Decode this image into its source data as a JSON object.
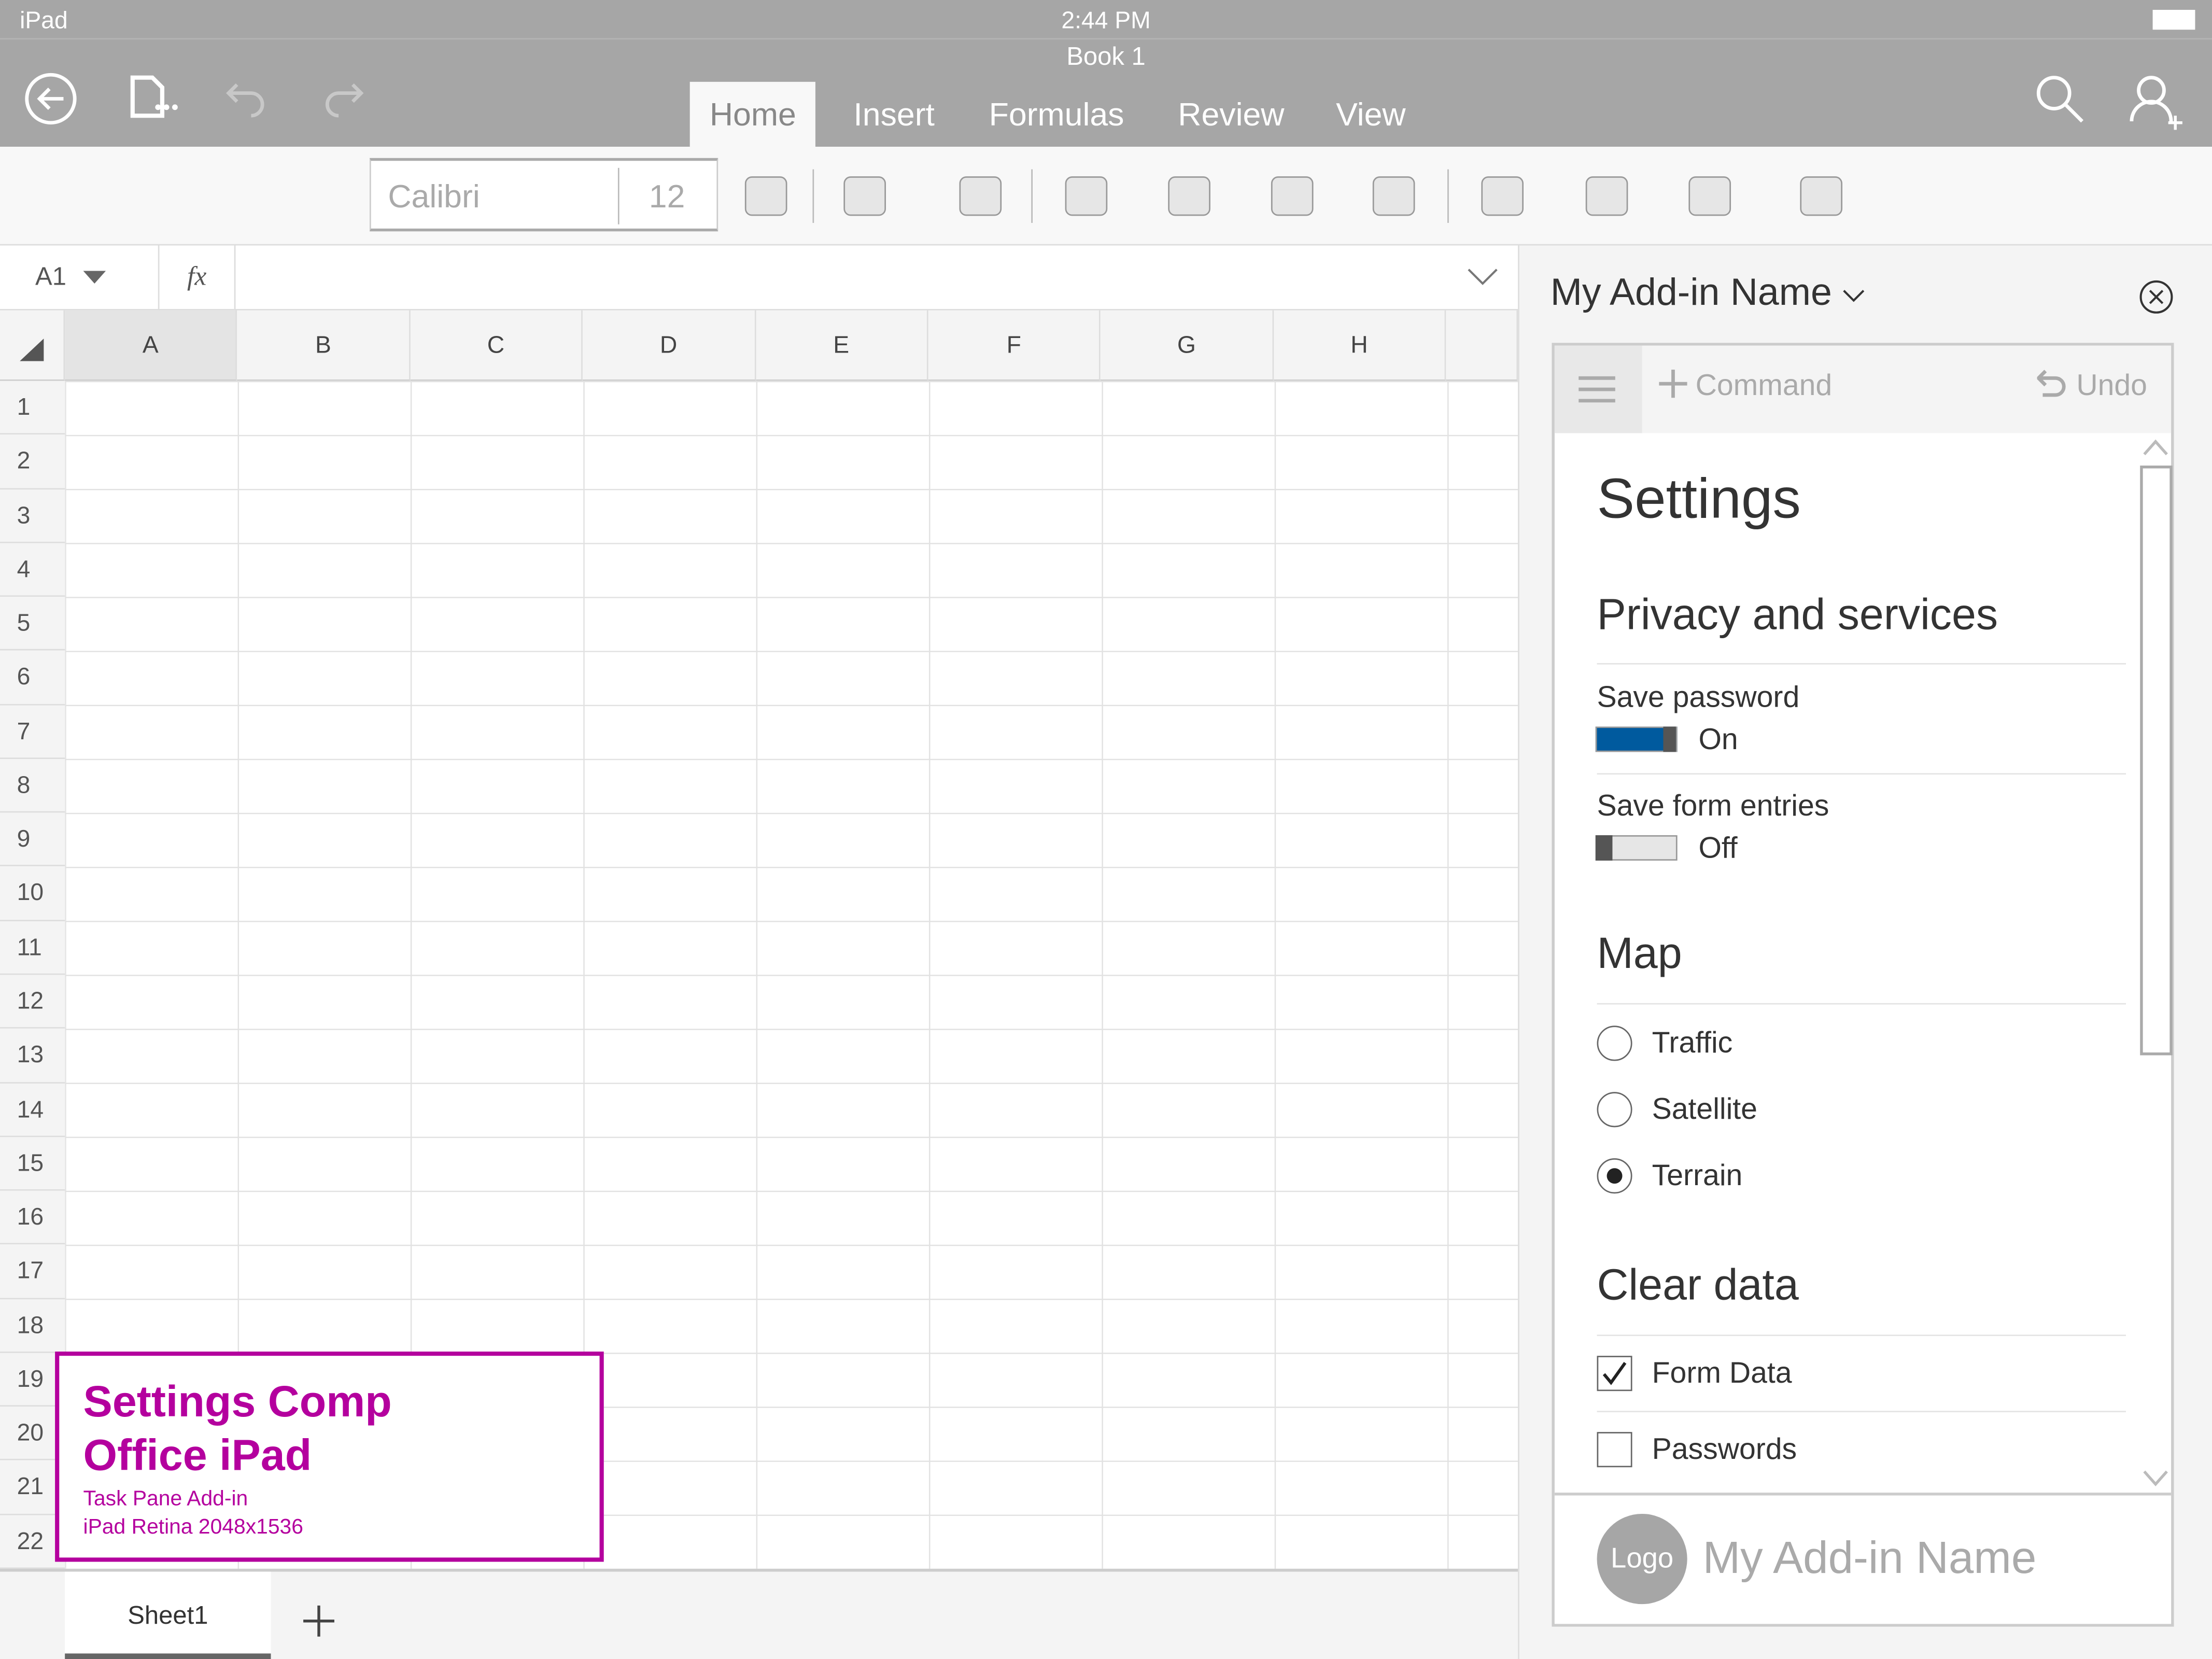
{
  "status_bar": {
    "device": "iPad",
    "time": "2:44 PM"
  },
  "title_bar": {
    "document_title": "Book 1"
  },
  "ribbon_tabs": [
    {
      "label": "Home",
      "active": true
    },
    {
      "label": "Insert"
    },
    {
      "label": "Formulas"
    },
    {
      "label": "Review"
    },
    {
      "label": "View"
    }
  ],
  "ribbon": {
    "font_name": "Calibri",
    "font_size": "12"
  },
  "formula_bar": {
    "name_box": "A1",
    "fx_label": "fx",
    "value": ""
  },
  "columns": [
    "A",
    "B",
    "C",
    "D",
    "E",
    "F",
    "G",
    "H"
  ],
  "rows": [
    "1",
    "2",
    "3",
    "4",
    "5",
    "6",
    "7",
    "8",
    "9",
    "10",
    "11",
    "12",
    "13",
    "14",
    "15",
    "16",
    "17",
    "18",
    "19",
    "20",
    "21",
    "22"
  ],
  "sheets": [
    {
      "label": "Sheet1",
      "active": true
    }
  ],
  "annotation": {
    "title_line1": "Settings Comp",
    "title_line2": "Office iPad",
    "sub_line1": "Task Pane Add-in",
    "sub_line2": "iPad Retina 2048x1536",
    "color": "#b4009e"
  },
  "task_pane": {
    "title": "My Add-in Name",
    "command_label": "Command",
    "undo_label": "Undo",
    "page_title": "Settings",
    "privacy": {
      "heading": "Privacy and services",
      "toggles": [
        {
          "label": "Save password",
          "state": "On",
          "on": true
        },
        {
          "label": "Save form entries",
          "state": "Off",
          "on": false
        }
      ]
    },
    "map": {
      "heading": "Map",
      "options": [
        {
          "label": "Traffic",
          "selected": false
        },
        {
          "label": "Satellite",
          "selected": false
        },
        {
          "label": "Terrain",
          "selected": true
        }
      ]
    },
    "clear_data": {
      "heading": "Clear data",
      "options": [
        {
          "label": "Form Data",
          "checked": true
        },
        {
          "label": "Passwords",
          "checked": false
        }
      ]
    },
    "footer": {
      "logo_text": "Logo",
      "name": "My Add-in Name"
    },
    "accent": "#005a9e"
  }
}
